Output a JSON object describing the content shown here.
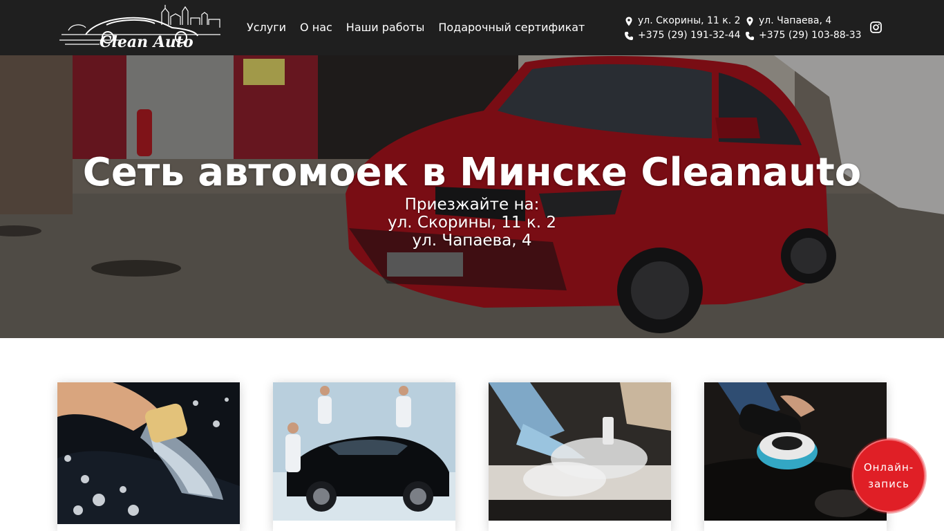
{
  "header": {
    "logo_text": "Clean Auto",
    "nav": [
      {
        "label": "Услуги"
      },
      {
        "label": "О нас"
      },
      {
        "label": "Наши работы"
      },
      {
        "label": "Подарочный сертификат"
      }
    ],
    "locations": [
      {
        "address": "ул. Скорины, 11 к. 2",
        "phone": "+375 (29) 191-32-44"
      },
      {
        "address": "ул. Чапаева, 4",
        "phone": "+375 (29) 103-88-33"
      }
    ],
    "social_icon": "instagram-icon"
  },
  "hero": {
    "title": "Сеть автомоек в Минске Cleanauto",
    "subtitle_lines": [
      "Приезжайте на:",
      "ул. Скорины, 11 к. 2",
      "ул. Чапаева, 4"
    ]
  },
  "cards": [
    {
      "image": "hand-wash-sponge-photo"
    },
    {
      "image": "car-detailing-team-photo"
    },
    {
      "image": "steam-cleaning-interior-photo"
    },
    {
      "image": "polishing-machine-photo"
    }
  ],
  "cta": {
    "label": "Онлайн-запись"
  },
  "colors": {
    "header_bg": "#1f1f1f",
    "accent": "#e01f26",
    "car_red": "#a8121d"
  }
}
